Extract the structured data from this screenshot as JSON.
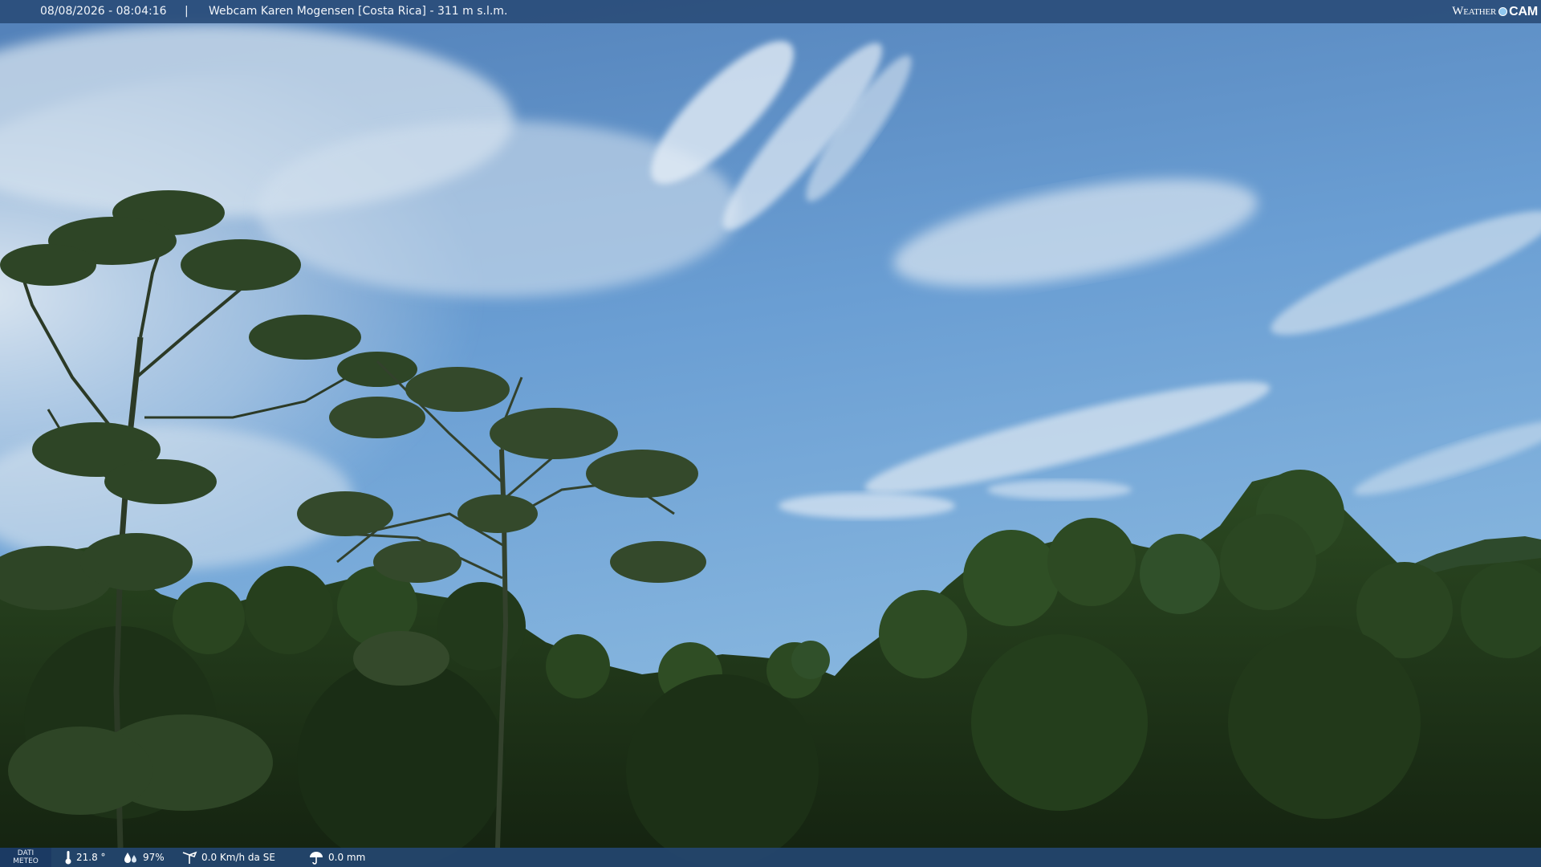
{
  "overlay": {
    "datetime": "08/08/2026 - 08:04:16",
    "separator": "|",
    "camera_name": "Webcam Karen Mogensen [Costa Rica]  - 311 m s.l.m.",
    "brand": {
      "word1": "Weather",
      "word2": "CAM"
    }
  },
  "meteo": {
    "label_line1": "DATI",
    "label_line2": "METEO",
    "temperature": "21.8 °",
    "humidity": "97%",
    "wind": "0.0 Km/h da SE",
    "rain": "0.0 mm"
  },
  "icons": {
    "temperature": "thermometer-icon",
    "humidity": "humidity-drops-icon",
    "wind": "wind-vane-icon",
    "rain": "rain-umbrella-icon",
    "brand": "weathercam-logo"
  },
  "colors": {
    "sky_top": "#4a79b3",
    "sky_bottom": "#7fb1df",
    "foliage": "#1f3418",
    "bar": "#284a76"
  }
}
